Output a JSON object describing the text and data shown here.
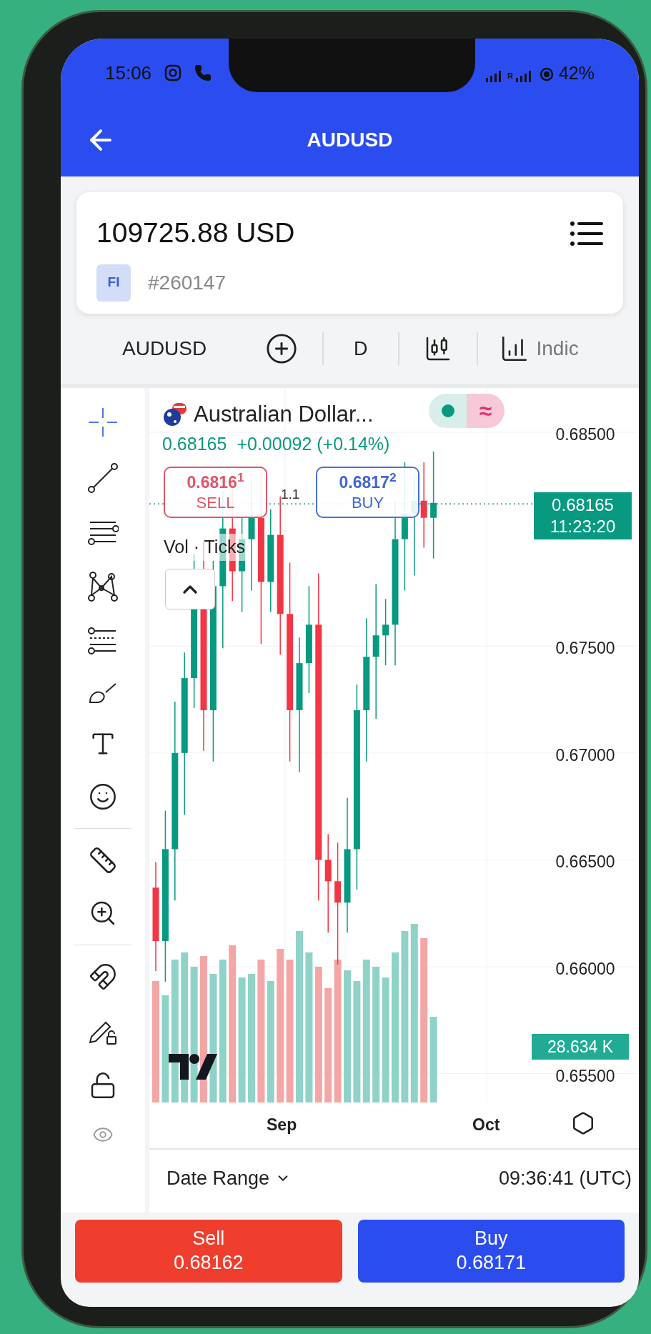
{
  "status_bar": {
    "time": "15:06",
    "roaming": "R",
    "battery": "42%"
  },
  "header": {
    "title": "AUDUSD"
  },
  "account": {
    "balance": "109725.88 USD",
    "badge": "FI",
    "number": "#260147"
  },
  "toolbar": {
    "symbol": "AUDUSD",
    "interval": "D",
    "indicators": "Indic"
  },
  "chart": {
    "title": "Australian Dollar...",
    "mode_symbol": "≈",
    "quote": "0.68165",
    "change": "+0.00092 (+0.14%)",
    "sell": {
      "price": "0.6816$^{1}$",
      "label": "SELL"
    },
    "spread": "1.1",
    "buy": {
      "price": "0.6817$^{2}$",
      "label": "BUY"
    },
    "volume_legend": "Vol · Ticks",
    "price_axis": [
      "0.68500",
      "0.67500",
      "0.67000",
      "0.66500",
      "0.66000",
      "0.65500"
    ],
    "last_price": "0.68165",
    "countdown": "11:23:20",
    "volume_tag": "28.634 K",
    "time_axis": [
      "Sep",
      "Oct"
    ]
  },
  "footer": {
    "date_range": "Date Range",
    "clock": "09:36:41 (UTC)"
  },
  "actions": [
    {
      "kind": "sell",
      "label": "Sell",
      "price": "0.68162"
    },
    {
      "kind": "buy",
      "label": "Buy",
      "price": "0.68171"
    }
  ]
}
